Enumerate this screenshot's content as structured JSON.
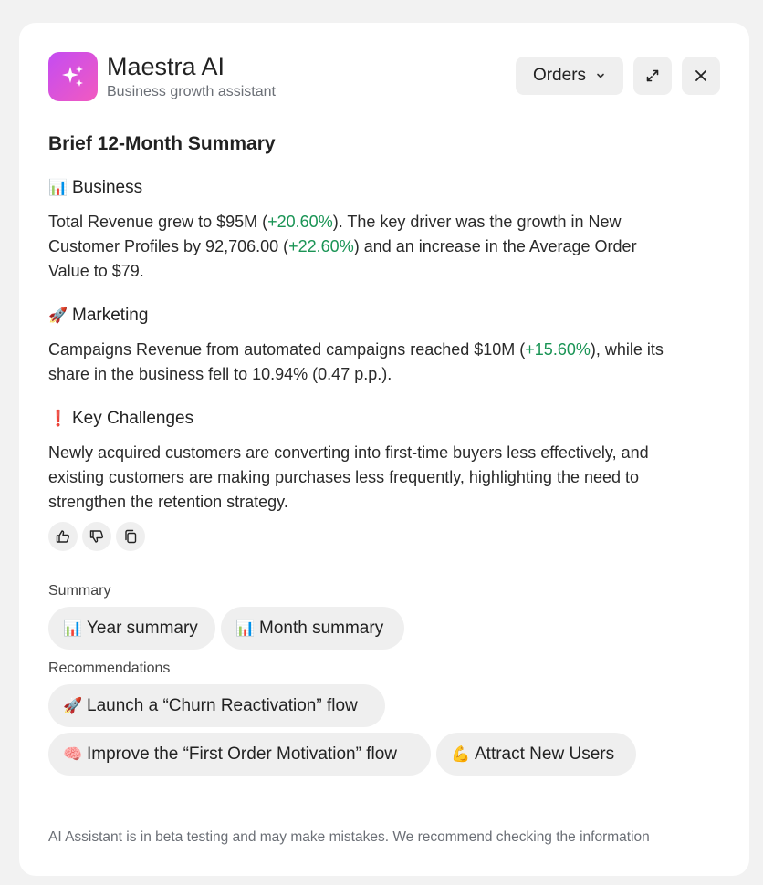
{
  "app": {
    "name": "Maestra AI",
    "subtitle": "Business growth assistant",
    "logo_icon": "sparkles-icon",
    "accent": "#d24fe0"
  },
  "header": {
    "dropdown_label": "Orders",
    "expand_icon": "expand-icon",
    "close_icon": "close-icon"
  },
  "brief": {
    "title": "Brief 12-Month Summary",
    "business": {
      "emoji": "📊",
      "title": "Business",
      "p1": "Total Revenue grew to $95M (",
      "v1": "+20.60%",
      "p2": "). The key driver was the growth in New Customer Profiles by 92,706.00 (",
      "v2": "+22.60%",
      "p3": ") and an increase in the Average Order Value to $79."
    },
    "marketing": {
      "emoji": "🚀",
      "title": "Marketing",
      "p1": "Campaigns Revenue from automated campaigns reached $10M (",
      "v1": "+15.60%",
      "p2": "), while its share in the business fell to 10.94% (0.47 p.p.)."
    },
    "challenges": {
      "emoji": "❗",
      "title": "Key Challenges",
      "text": "Newly acquired customers are converting into first-time buyers less effectively, and existing customers are making purchases less frequently, highlighting the need to strengthen the retention strategy."
    },
    "positive_color": "#1a9455"
  },
  "feedback": {
    "like_icon": "thumbs-up-icon",
    "dislike_icon": "thumbs-down-icon",
    "copy_icon": "copy-icon"
  },
  "summary": {
    "label": "Summary",
    "chips": [
      {
        "emoji": "📊",
        "label": "Year summary"
      },
      {
        "emoji": "📊",
        "label": "Month summary"
      }
    ]
  },
  "recommendations": {
    "label": "Recommendations",
    "chips": [
      {
        "emoji": "🚀",
        "label": "Launch a “Churn Reactivation” flow"
      },
      {
        "emoji": "🧠",
        "label": "Improve the “First Order Motivation” flow"
      },
      {
        "emoji": "💪",
        "label": "Attract New Users"
      }
    ]
  },
  "footer": {
    "note": "AI Assistant is in beta testing and may make mistakes. We recommend checking the information"
  }
}
